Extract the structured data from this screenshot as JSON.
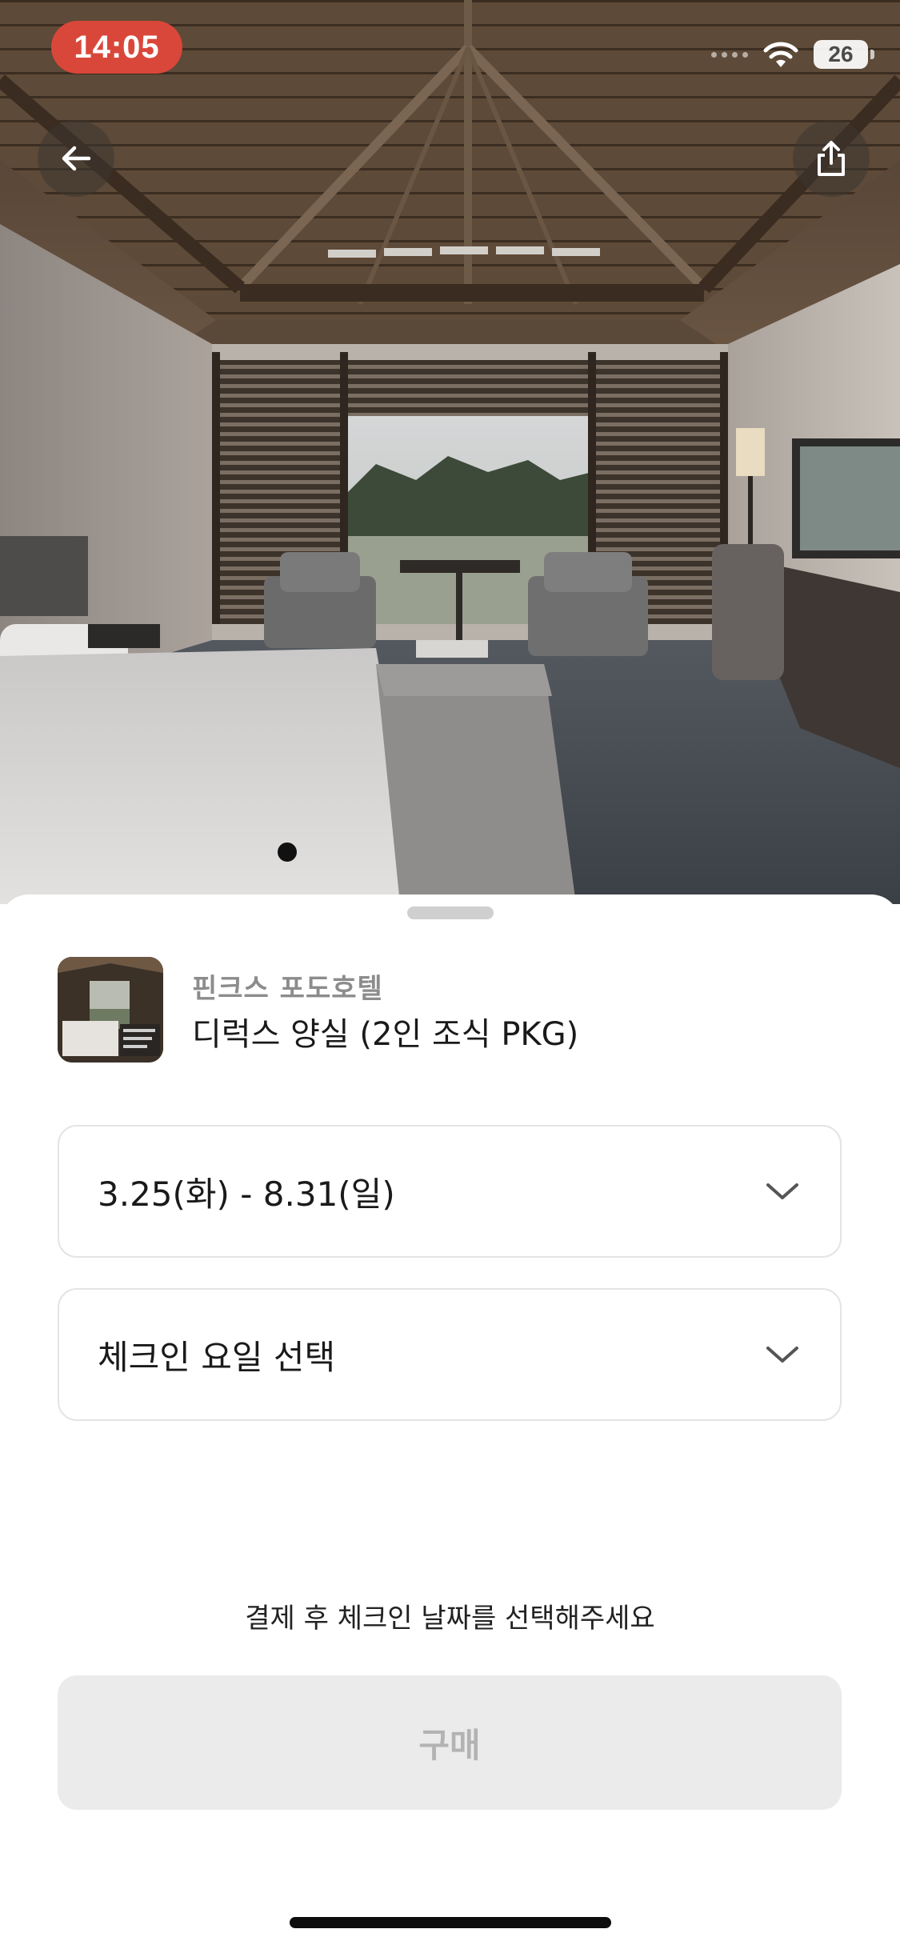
{
  "status_bar": {
    "time": "14:05",
    "battery": "26"
  },
  "hero": {
    "photo_subject": "hotel room with wooden vaulted ceiling, bed and patio view",
    "back_icon": "arrow-left-icon",
    "share_icon": "share-icon",
    "page_indicator_active": 1
  },
  "product": {
    "hotel_name": "핀크스 포도호텔",
    "room_name": "디럭스 양실 (2인 조식 PKG)"
  },
  "options": {
    "date_range": "3.25(화) - 8.31(일)",
    "checkin_day": "체크인 요일 선택",
    "chevron_icon": "chevron-down-icon"
  },
  "footer": {
    "helper_text": "결제 후 체크인 날짜를 선택해주세요",
    "buy_label": "구매"
  },
  "colors": {
    "time_pill": "#d9473a",
    "buy_button_bg": "#ebebeb",
    "buy_button_text": "#b3b3b3"
  }
}
